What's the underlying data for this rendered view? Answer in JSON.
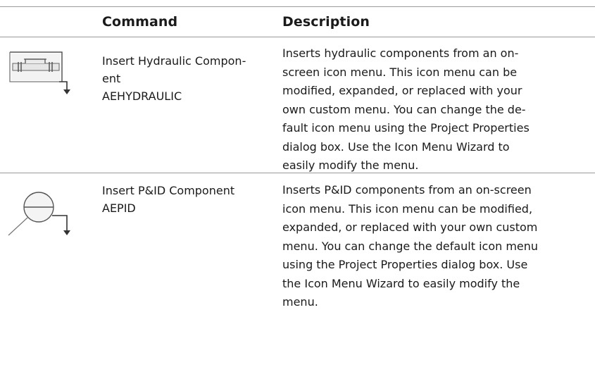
{
  "header": {
    "command": "Command",
    "description": "Description"
  },
  "rows": [
    {
      "icon": "hydraulic-component-icon",
      "command_lines": [
        "Insert Hydraulic Compon-",
        "ent",
        "AEHYDRAULIC"
      ],
      "description_lines": [
        "Inserts hydraulic components from an on-",
        "screen icon menu. This icon menu can be",
        "modified, expanded, or replaced with your",
        "own custom menu. You can change the de-",
        "fault icon menu using the Project Properties",
        "dialog box. Use the Icon Menu Wizard to",
        "easily modify the menu."
      ]
    },
    {
      "icon": "pid-component-icon",
      "command_lines": [
        "Insert P&ID Component",
        "AEPID"
      ],
      "description_lines": [
        "Inserts P&ID components from an on-screen",
        "icon menu. This icon menu can be modified,",
        "expanded, or replaced with your own custom",
        "menu. You can change the default icon menu",
        "using the Project Properties dialog box. Use",
        "the Icon Menu Wizard to easily modify the",
        "menu."
      ]
    }
  ]
}
